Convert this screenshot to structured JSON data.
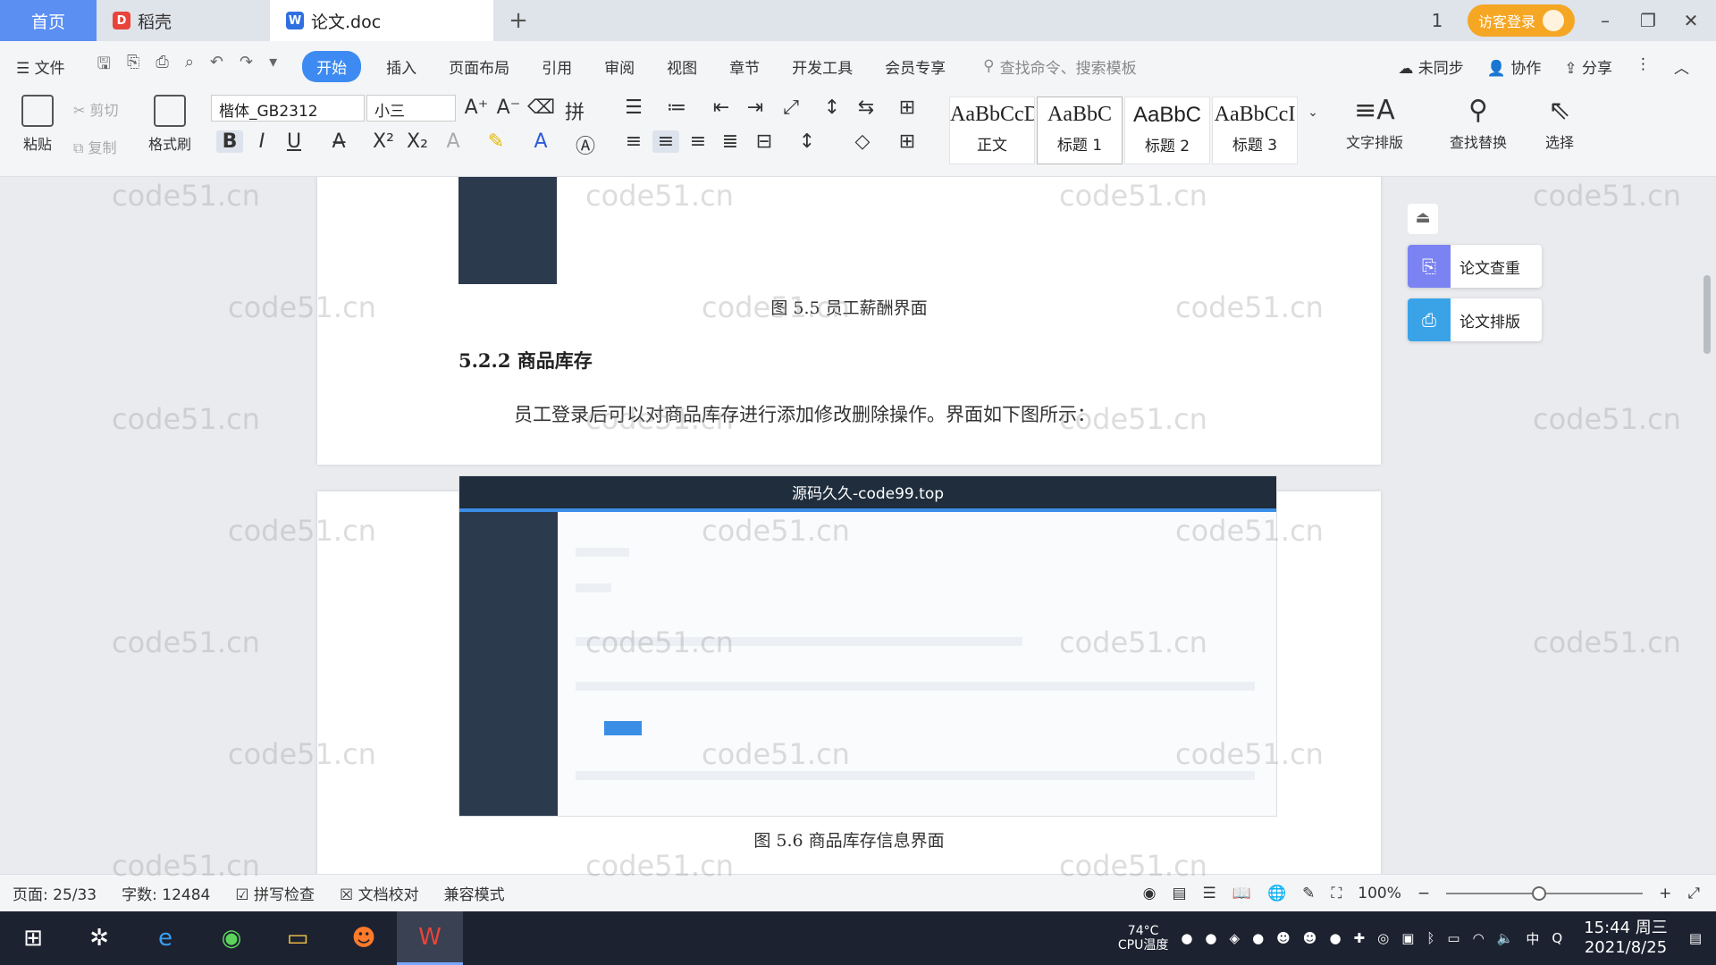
{
  "tabs": {
    "home": "首页",
    "daoke": "稻壳",
    "doc": "论文.doc",
    "new_tab": "+"
  },
  "titlebar": {
    "visitor_login": "访客登录",
    "page_indicator": "1"
  },
  "menu": {
    "file": "文件",
    "items": [
      "开始",
      "插入",
      "页面布局",
      "引用",
      "审阅",
      "视图",
      "章节",
      "开发工具",
      "会员专享"
    ],
    "active": "开始",
    "search_placeholder": "查找命令、搜索模板",
    "not_synced": "未同步",
    "collaborate": "协作",
    "share": "分享"
  },
  "ribbon": {
    "paste": "粘贴",
    "cut": "剪切",
    "copy": "复制",
    "format_painter": "格式刷",
    "font_name": "楷体_GB2312",
    "font_size": "小三",
    "styles": [
      {
        "sample": "AaBbCcDc",
        "name": "正文"
      },
      {
        "sample": "AaBbC",
        "name": "标题 1"
      },
      {
        "sample": "AaBbC",
        "name": "标题 2"
      },
      {
        "sample": "AaBbCcI",
        "name": "标题 3"
      }
    ],
    "text_layout": "文字排版",
    "find_replace": "查找替换",
    "select": "选择"
  },
  "document": {
    "fig55_caption": "图 5.5  员工薪酬界面",
    "section_heading": "5.2.2  商品库存",
    "paragraph": "员工登录后可以对商品库存进行添加修改删除操作。界面如下图所示：",
    "screenshot_banner": "源码久久-code99.top",
    "fig56_caption": "图 5.6  商品库存信息界面"
  },
  "side_panel": {
    "plagiarism_check": "论文查重",
    "thesis_layout": "论文排版"
  },
  "status": {
    "page": "页面: 25/33",
    "word_count": "字数: 12484",
    "spell_check": "拼写检查",
    "doc_proof": "文档校对",
    "compat_mode": "兼容模式",
    "zoom": "100%"
  },
  "taskbar": {
    "cpu_temp": "74°C",
    "cpu_label": "CPU温度",
    "time": "15:44 周三",
    "date": "2021/8/25",
    "ime": "中"
  },
  "watermark": "code51.cn",
  "colors": {
    "accent": "#3d8bf2",
    "home_tab": "#5b8ff2",
    "visitor": "#f5a623",
    "taskbar": "#1c2230"
  }
}
